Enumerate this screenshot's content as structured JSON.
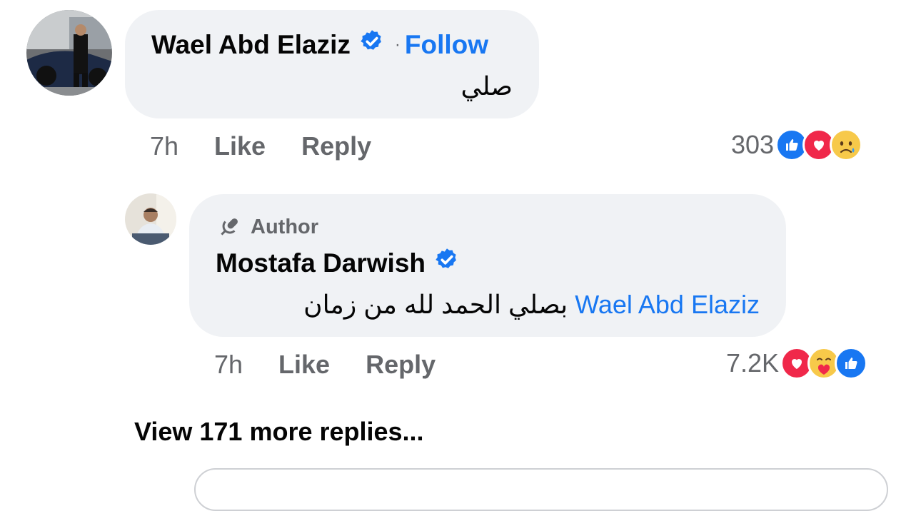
{
  "comment": {
    "author": "Wael Abd Elaziz",
    "separator": "·",
    "follow_label": "Follow",
    "text": "صلي",
    "time": "7h",
    "like_label": "Like",
    "reply_label": "Reply",
    "reaction_count": "303",
    "reactions": [
      "like-icon",
      "love-icon",
      "sad-icon"
    ]
  },
  "reply": {
    "author_badge": "Author",
    "author": "Mostafa Darwish",
    "mention": "Wael Abd Elaziz",
    "text": "بصلي الحمد لله من زمان",
    "time": "7h",
    "like_label": "Like",
    "reply_label": "Reply",
    "reaction_count": "7.2K",
    "reactions": [
      "love-icon",
      "care-icon",
      "like-icon"
    ]
  },
  "more_replies": "View 171 more replies...",
  "colors": {
    "accent": "#1877f2",
    "bubble": "#f0f2f5",
    "muted": "#65676b"
  }
}
